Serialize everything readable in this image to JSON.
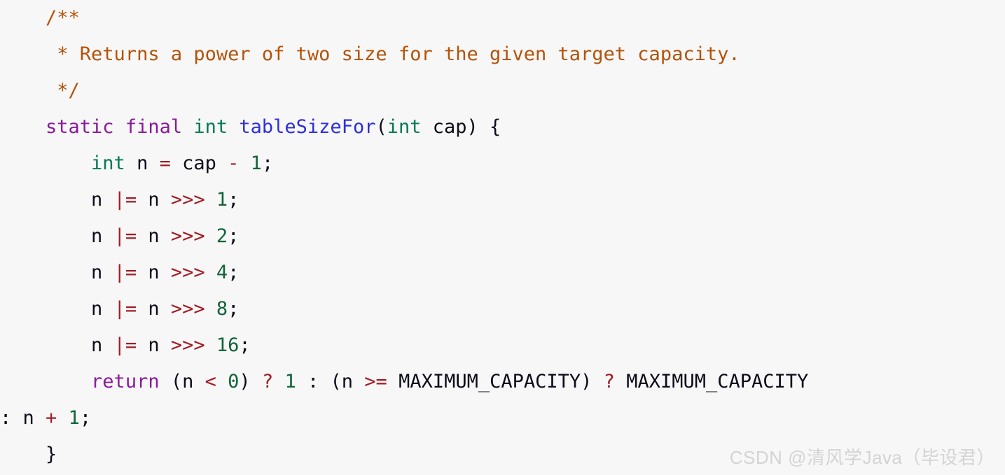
{
  "editor": {
    "background_color": "#f7f7f7",
    "language": "java",
    "font_size_px": 27,
    "line_height_px": 52
  },
  "palette": {
    "plain": "#0d0d1a",
    "comment": "#b35309",
    "keyword": "#8a1a9b",
    "type": "#047a56",
    "function": "#2f2fd6",
    "operator": "#a01c24",
    "number": "#12633c",
    "punctuation": "#0d0d1a",
    "watermark": "#d4d4d4"
  },
  "code": {
    "plain_text": "    /**\n     * Returns a power of two size for the given target capacity.\n     */\n    static final int tableSizeFor(int cap) {\n        int n = cap - 1;\n        n |= n >>> 1;\n        n |= n >>> 2;\n        n |= n >>> 4;\n        n |= n >>> 8;\n        n |= n >>> 16;\n        return (n < 0) ? 1 : (n >= MAXIMUM_CAPACITY) ? MAXIMUM_CAPACITY : n + 1;\n    }",
    "lines": [
      {
        "id": "line-comment-open",
        "tokens": [
          {
            "t": "    ",
            "c": "plain"
          },
          {
            "t": "/**",
            "c": "comment"
          }
        ]
      },
      {
        "id": "line-comment-body",
        "tokens": [
          {
            "t": "     ",
            "c": "plain"
          },
          {
            "t": "* Returns a power of two size for the given target capacity.",
            "c": "comment"
          }
        ]
      },
      {
        "id": "line-comment-close",
        "tokens": [
          {
            "t": "     ",
            "c": "plain"
          },
          {
            "t": "*/",
            "c": "comment"
          }
        ]
      },
      {
        "id": "line-method-signature",
        "tokens": [
          {
            "t": "    ",
            "c": "plain"
          },
          {
            "t": "static final ",
            "c": "keyword"
          },
          {
            "t": "int ",
            "c": "type"
          },
          {
            "t": "tableSizeFor",
            "c": "function"
          },
          {
            "t": "(",
            "c": "punct"
          },
          {
            "t": "int ",
            "c": "type"
          },
          {
            "t": "cap",
            "c": "plain"
          },
          {
            "t": ") {",
            "c": "punct"
          }
        ]
      },
      {
        "id": "line-int-n-decl",
        "tokens": [
          {
            "t": "        ",
            "c": "plain"
          },
          {
            "t": "int ",
            "c": "type"
          },
          {
            "t": "n ",
            "c": "plain"
          },
          {
            "t": "=",
            "c": "op"
          },
          {
            "t": " cap ",
            "c": "plain"
          },
          {
            "t": "-",
            "c": "op"
          },
          {
            "t": " ",
            "c": "plain"
          },
          {
            "t": "1",
            "c": "num"
          },
          {
            "t": ";",
            "c": "punct"
          }
        ]
      },
      {
        "id": "line-shift-1",
        "tokens": [
          {
            "t": "        ",
            "c": "plain"
          },
          {
            "t": "n ",
            "c": "plain"
          },
          {
            "t": "|=",
            "c": "op"
          },
          {
            "t": " n ",
            "c": "plain"
          },
          {
            "t": ">>>",
            "c": "op"
          },
          {
            "t": " ",
            "c": "plain"
          },
          {
            "t": "1",
            "c": "num"
          },
          {
            "t": ";",
            "c": "punct"
          }
        ]
      },
      {
        "id": "line-shift-2",
        "tokens": [
          {
            "t": "        ",
            "c": "plain"
          },
          {
            "t": "n ",
            "c": "plain"
          },
          {
            "t": "|=",
            "c": "op"
          },
          {
            "t": " n ",
            "c": "plain"
          },
          {
            "t": ">>>",
            "c": "op"
          },
          {
            "t": " ",
            "c": "plain"
          },
          {
            "t": "2",
            "c": "num"
          },
          {
            "t": ";",
            "c": "punct"
          }
        ]
      },
      {
        "id": "line-shift-4",
        "tokens": [
          {
            "t": "        ",
            "c": "plain"
          },
          {
            "t": "n ",
            "c": "plain"
          },
          {
            "t": "|=",
            "c": "op"
          },
          {
            "t": " n ",
            "c": "plain"
          },
          {
            "t": ">>>",
            "c": "op"
          },
          {
            "t": " ",
            "c": "plain"
          },
          {
            "t": "4",
            "c": "num"
          },
          {
            "t": ";",
            "c": "punct"
          }
        ]
      },
      {
        "id": "line-shift-8",
        "tokens": [
          {
            "t": "        ",
            "c": "plain"
          },
          {
            "t": "n ",
            "c": "plain"
          },
          {
            "t": "|=",
            "c": "op"
          },
          {
            "t": " n ",
            "c": "plain"
          },
          {
            "t": ">>>",
            "c": "op"
          },
          {
            "t": " ",
            "c": "plain"
          },
          {
            "t": "8",
            "c": "num"
          },
          {
            "t": ";",
            "c": "punct"
          }
        ]
      },
      {
        "id": "line-shift-16",
        "tokens": [
          {
            "t": "        ",
            "c": "plain"
          },
          {
            "t": "n ",
            "c": "plain"
          },
          {
            "t": "|=",
            "c": "op"
          },
          {
            "t": " n ",
            "c": "plain"
          },
          {
            "t": ">>>",
            "c": "op"
          },
          {
            "t": " ",
            "c": "plain"
          },
          {
            "t": "16",
            "c": "num"
          },
          {
            "t": ";",
            "c": "punct"
          }
        ]
      },
      {
        "id": "line-return-ternary",
        "tokens": [
          {
            "t": "        ",
            "c": "plain"
          },
          {
            "t": "return",
            "c": "keyword"
          },
          {
            "t": " (n ",
            "c": "punct"
          },
          {
            "t": "<",
            "c": "op"
          },
          {
            "t": " ",
            "c": "plain"
          },
          {
            "t": "0",
            "c": "num"
          },
          {
            "t": ") ",
            "c": "punct"
          },
          {
            "t": "?",
            "c": "op"
          },
          {
            "t": " ",
            "c": "plain"
          },
          {
            "t": "1",
            "c": "num"
          },
          {
            "t": " : ",
            "c": "punct"
          },
          {
            "t": "(n ",
            "c": "punct"
          },
          {
            "t": ">=",
            "c": "op"
          },
          {
            "t": " MAXIMUM_CAPACITY) ",
            "c": "plain"
          },
          {
            "t": "?",
            "c": "op"
          },
          {
            "t": " MAXIMUM_CAPACITY",
            "c": "plain"
          }
        ]
      },
      {
        "id": "line-return-wrapped",
        "tokens": [
          {
            "t": ": n ",
            "c": "punct"
          },
          {
            "t": "+",
            "c": "op"
          },
          {
            "t": " ",
            "c": "plain"
          },
          {
            "t": "1",
            "c": "num"
          },
          {
            "t": ";",
            "c": "punct"
          }
        ]
      },
      {
        "id": "line-method-close",
        "tokens": [
          {
            "t": "    ",
            "c": "plain"
          },
          {
            "t": "}",
            "c": "punct"
          }
        ]
      }
    ]
  },
  "watermark": {
    "text": "CSDN @清风学Java（毕设君）"
  }
}
